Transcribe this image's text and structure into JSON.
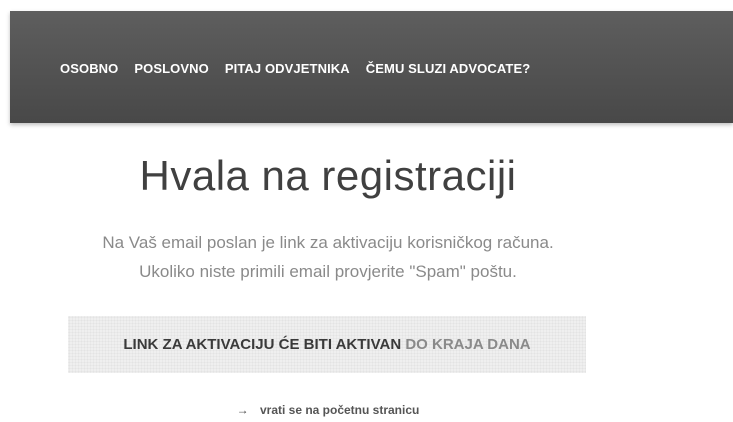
{
  "nav": {
    "items": [
      {
        "label": "OSOBNO"
      },
      {
        "label": "POSLOVNO"
      },
      {
        "label": "PITAJ ODVJETNIKA"
      },
      {
        "label": "ČEMU SLUZI ADVOCATE?"
      }
    ]
  },
  "main": {
    "title": "Hvala na registraciji",
    "message_line1": "Na Vaš email poslan je link za aktivaciju korisničkog računa.",
    "message_line2": "Ukoliko niste primili email provjerite \"Spam\" poštu.",
    "banner_strong": "LINK ZA AKTIVACIJU ĆE BITI AKTIVAN",
    "banner_light": "DO KRAJA DANA",
    "back_arrow": "→",
    "back_link": "vrati se na početnu stranicu"
  },
  "colors": {
    "nav_background": "#555555",
    "title": "#404040",
    "muted_text": "#8a8a8a",
    "banner_background": "#efefef"
  }
}
